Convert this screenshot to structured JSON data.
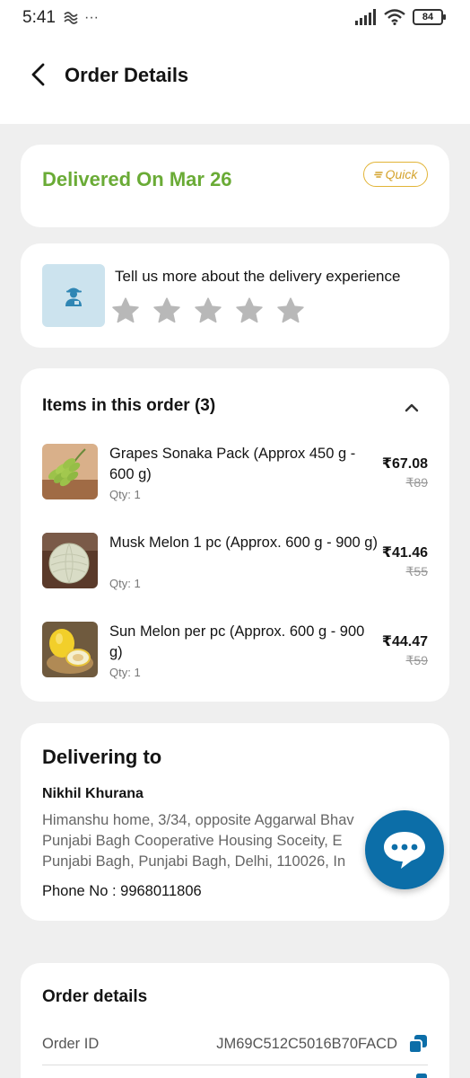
{
  "status_bar": {
    "time": "5:41",
    "more_dots": "···",
    "battery": "84"
  },
  "header": {
    "title": "Order Details"
  },
  "delivery_status": {
    "text": "Delivered On Mar 26",
    "badge": "Quick",
    "color": "#6aab36"
  },
  "feedback": {
    "prompt": "Tell us more about the delivery experience",
    "rating_stars": 5,
    "rating_value": 0
  },
  "items": {
    "title": "Items in this order (3)",
    "list": [
      {
        "name": "Grapes Sonaka Pack (Approx 450 g - 600 g)",
        "qty": "Qty: 1",
        "price": "₹67.08",
        "mrp": "₹89"
      },
      {
        "name": "Musk Melon 1 pc (Approx. 600 g - 900 g)",
        "qty": "Qty: 1",
        "price": "₹41.46",
        "mrp": "₹55"
      },
      {
        "name": "Sun Melon per pc (Approx. 600 g - 900 g)",
        "qty": "Qty: 1",
        "price": "₹44.47",
        "mrp": "₹59"
      }
    ]
  },
  "address": {
    "title": "Delivering to",
    "name": "Nikhil Khurana",
    "lines": [
      "Himanshu home, 3/34, opposite Aggarwal Bhav",
      "Punjabi Bagh Cooperative Housing Soceity, E",
      "Punjabi Bagh, Punjabi Bagh, Delhi, 110026, In"
    ],
    "phone": "Phone No : 9968011806"
  },
  "order_details": {
    "title": "Order details",
    "order_id_label": "Order ID",
    "order_id_value": "JM69C512C5016B70FACD"
  },
  "colors": {
    "accent_blue": "#0c6ea8",
    "delivered_green": "#6aab36",
    "quick_badge": "#e2b437"
  }
}
